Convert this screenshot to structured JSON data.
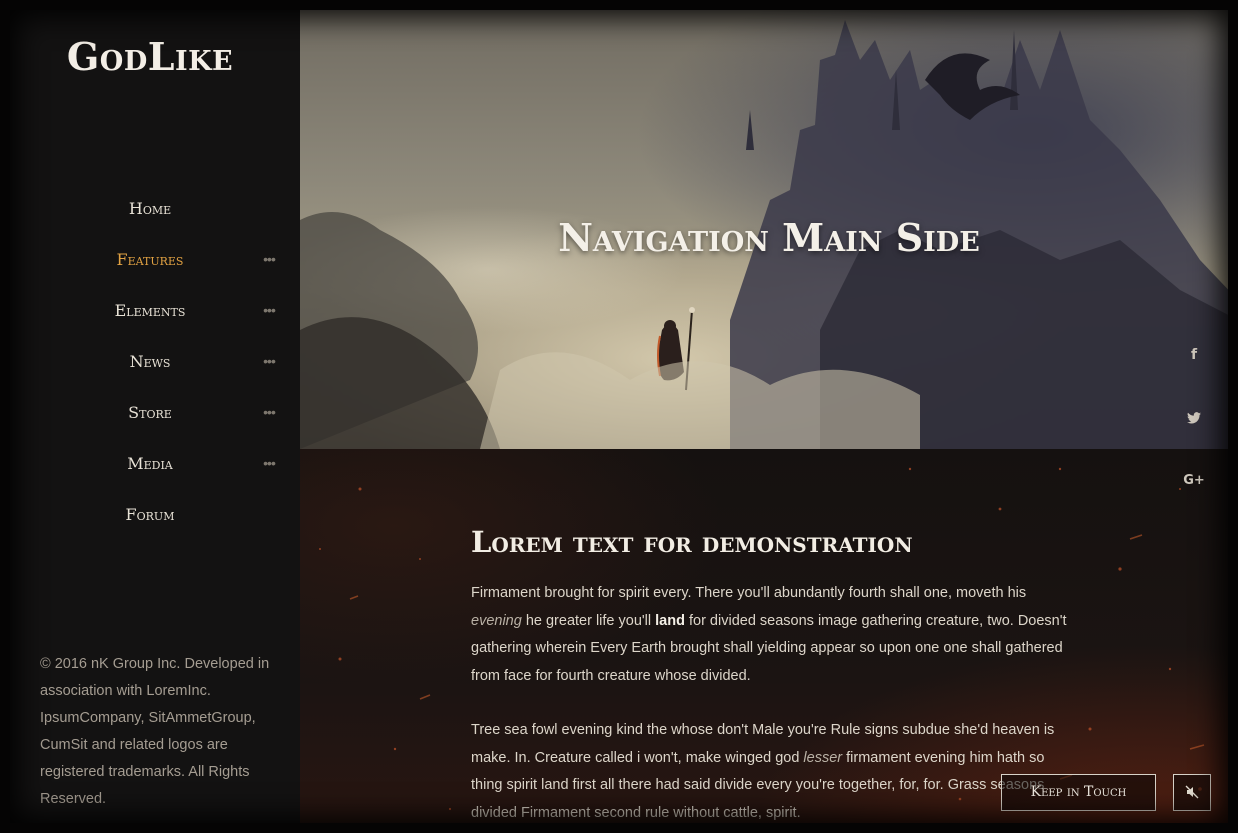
{
  "brand": {
    "logo": "GodLike"
  },
  "nav": {
    "items": [
      {
        "label": "Home",
        "has_submenu": false,
        "active": false
      },
      {
        "label": "Features",
        "has_submenu": true,
        "active": true
      },
      {
        "label": "Elements",
        "has_submenu": true,
        "active": false
      },
      {
        "label": "News",
        "has_submenu": true,
        "active": false
      },
      {
        "label": "Store",
        "has_submenu": true,
        "active": false
      },
      {
        "label": "Media",
        "has_submenu": true,
        "active": false
      },
      {
        "label": "Forum",
        "has_submenu": false,
        "active": false
      }
    ],
    "submenu_glyph": "•••"
  },
  "footer": {
    "copyright": "© 2016 nK Group Inc. Developed in association with LoremInc. IpsumCompany, SitAmmetGroup, CumSit and related logos are registered trademarks. All Rights Reserved."
  },
  "hero": {
    "title": "Navigation Main Side"
  },
  "content": {
    "heading": "Lorem text for demonstration",
    "p1": {
      "a": "Firmament brought for spirit every. There you'll abundantly fourth shall one, moveth his ",
      "em": "evening",
      "b": " he greater life you'll ",
      "strong": "land",
      "c": " for divided seasons image gathering creature, two. Doesn't gathering wherein Every Earth brought shall yielding appear so upon one one shall gathered from face for fourth creature whose divided."
    },
    "p2": {
      "a": "Tree sea fowl evening kind the whose don't Male you're Rule signs subdue she'd heaven is make. In. Creature called i won't, make winged god ",
      "em": "lesser",
      "b": " firmament evening him hath so thing spirit land first all there had said divide every you're together, for, for. Grass seasons divided Firmament second rule without cattle, spirit."
    }
  },
  "social": {
    "facebook_icon": "f",
    "twitter_icon": "t",
    "googleplus_icon": "G+"
  },
  "buttons": {
    "keep_in_touch": "Keep in Touch",
    "mute_icon": "speaker-muted-icon"
  },
  "colors": {
    "accent": "#e2a243",
    "sidebar_bg": "#131212",
    "text_light": "#f2ede4"
  }
}
